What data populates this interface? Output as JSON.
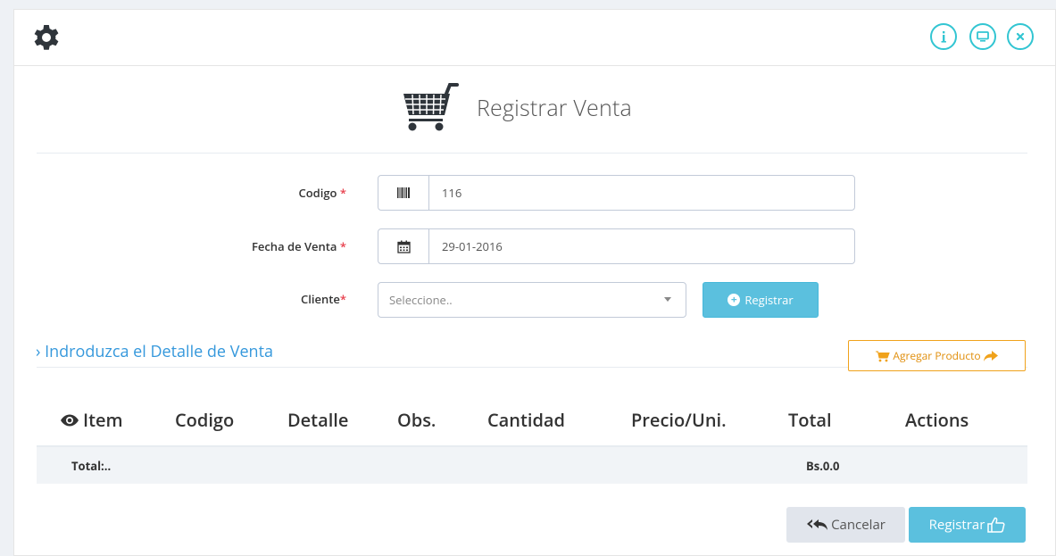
{
  "header": {
    "settings_icon": "gear-icon",
    "buttons": [
      {
        "icon": "info-icon",
        "label": "Info"
      },
      {
        "icon": "monitor-icon",
        "label": "Fullscreen"
      },
      {
        "icon": "close-icon",
        "label": "Close"
      }
    ]
  },
  "page": {
    "title": "Registrar Venta",
    "title_icon": "shopping-cart-icon"
  },
  "form": {
    "codigo": {
      "label": "Codigo",
      "required_mark": "*",
      "value": "116",
      "icon": "barcode-icon"
    },
    "fecha": {
      "label": "Fecha de Venta",
      "required_mark": "*",
      "value": "29-01-2016",
      "icon": "calendar-icon"
    },
    "cliente": {
      "label": "Cliente",
      "required_mark": "*",
      "placeholder": "Seleccione..",
      "button_label": "Registrar"
    }
  },
  "detail": {
    "title": "› Indroduzca el Detalle de Venta",
    "add_button_label": "Agregar Producto"
  },
  "table": {
    "columns": [
      "Item",
      "Codigo",
      "Detalle",
      "Obs.",
      "Cantidad",
      "Precio/Uni.",
      "Total",
      "Actions"
    ],
    "total_label": "Total:..",
    "total_value": "Bs.0.0"
  },
  "footer": {
    "cancel_label": "Cancelar",
    "submit_label": "Registrar"
  },
  "colors": {
    "accent": "#32c5d2",
    "info": "#5bc0de",
    "link": "#3598dc",
    "warning": "#f0a21b",
    "required": "#e73d4a"
  }
}
